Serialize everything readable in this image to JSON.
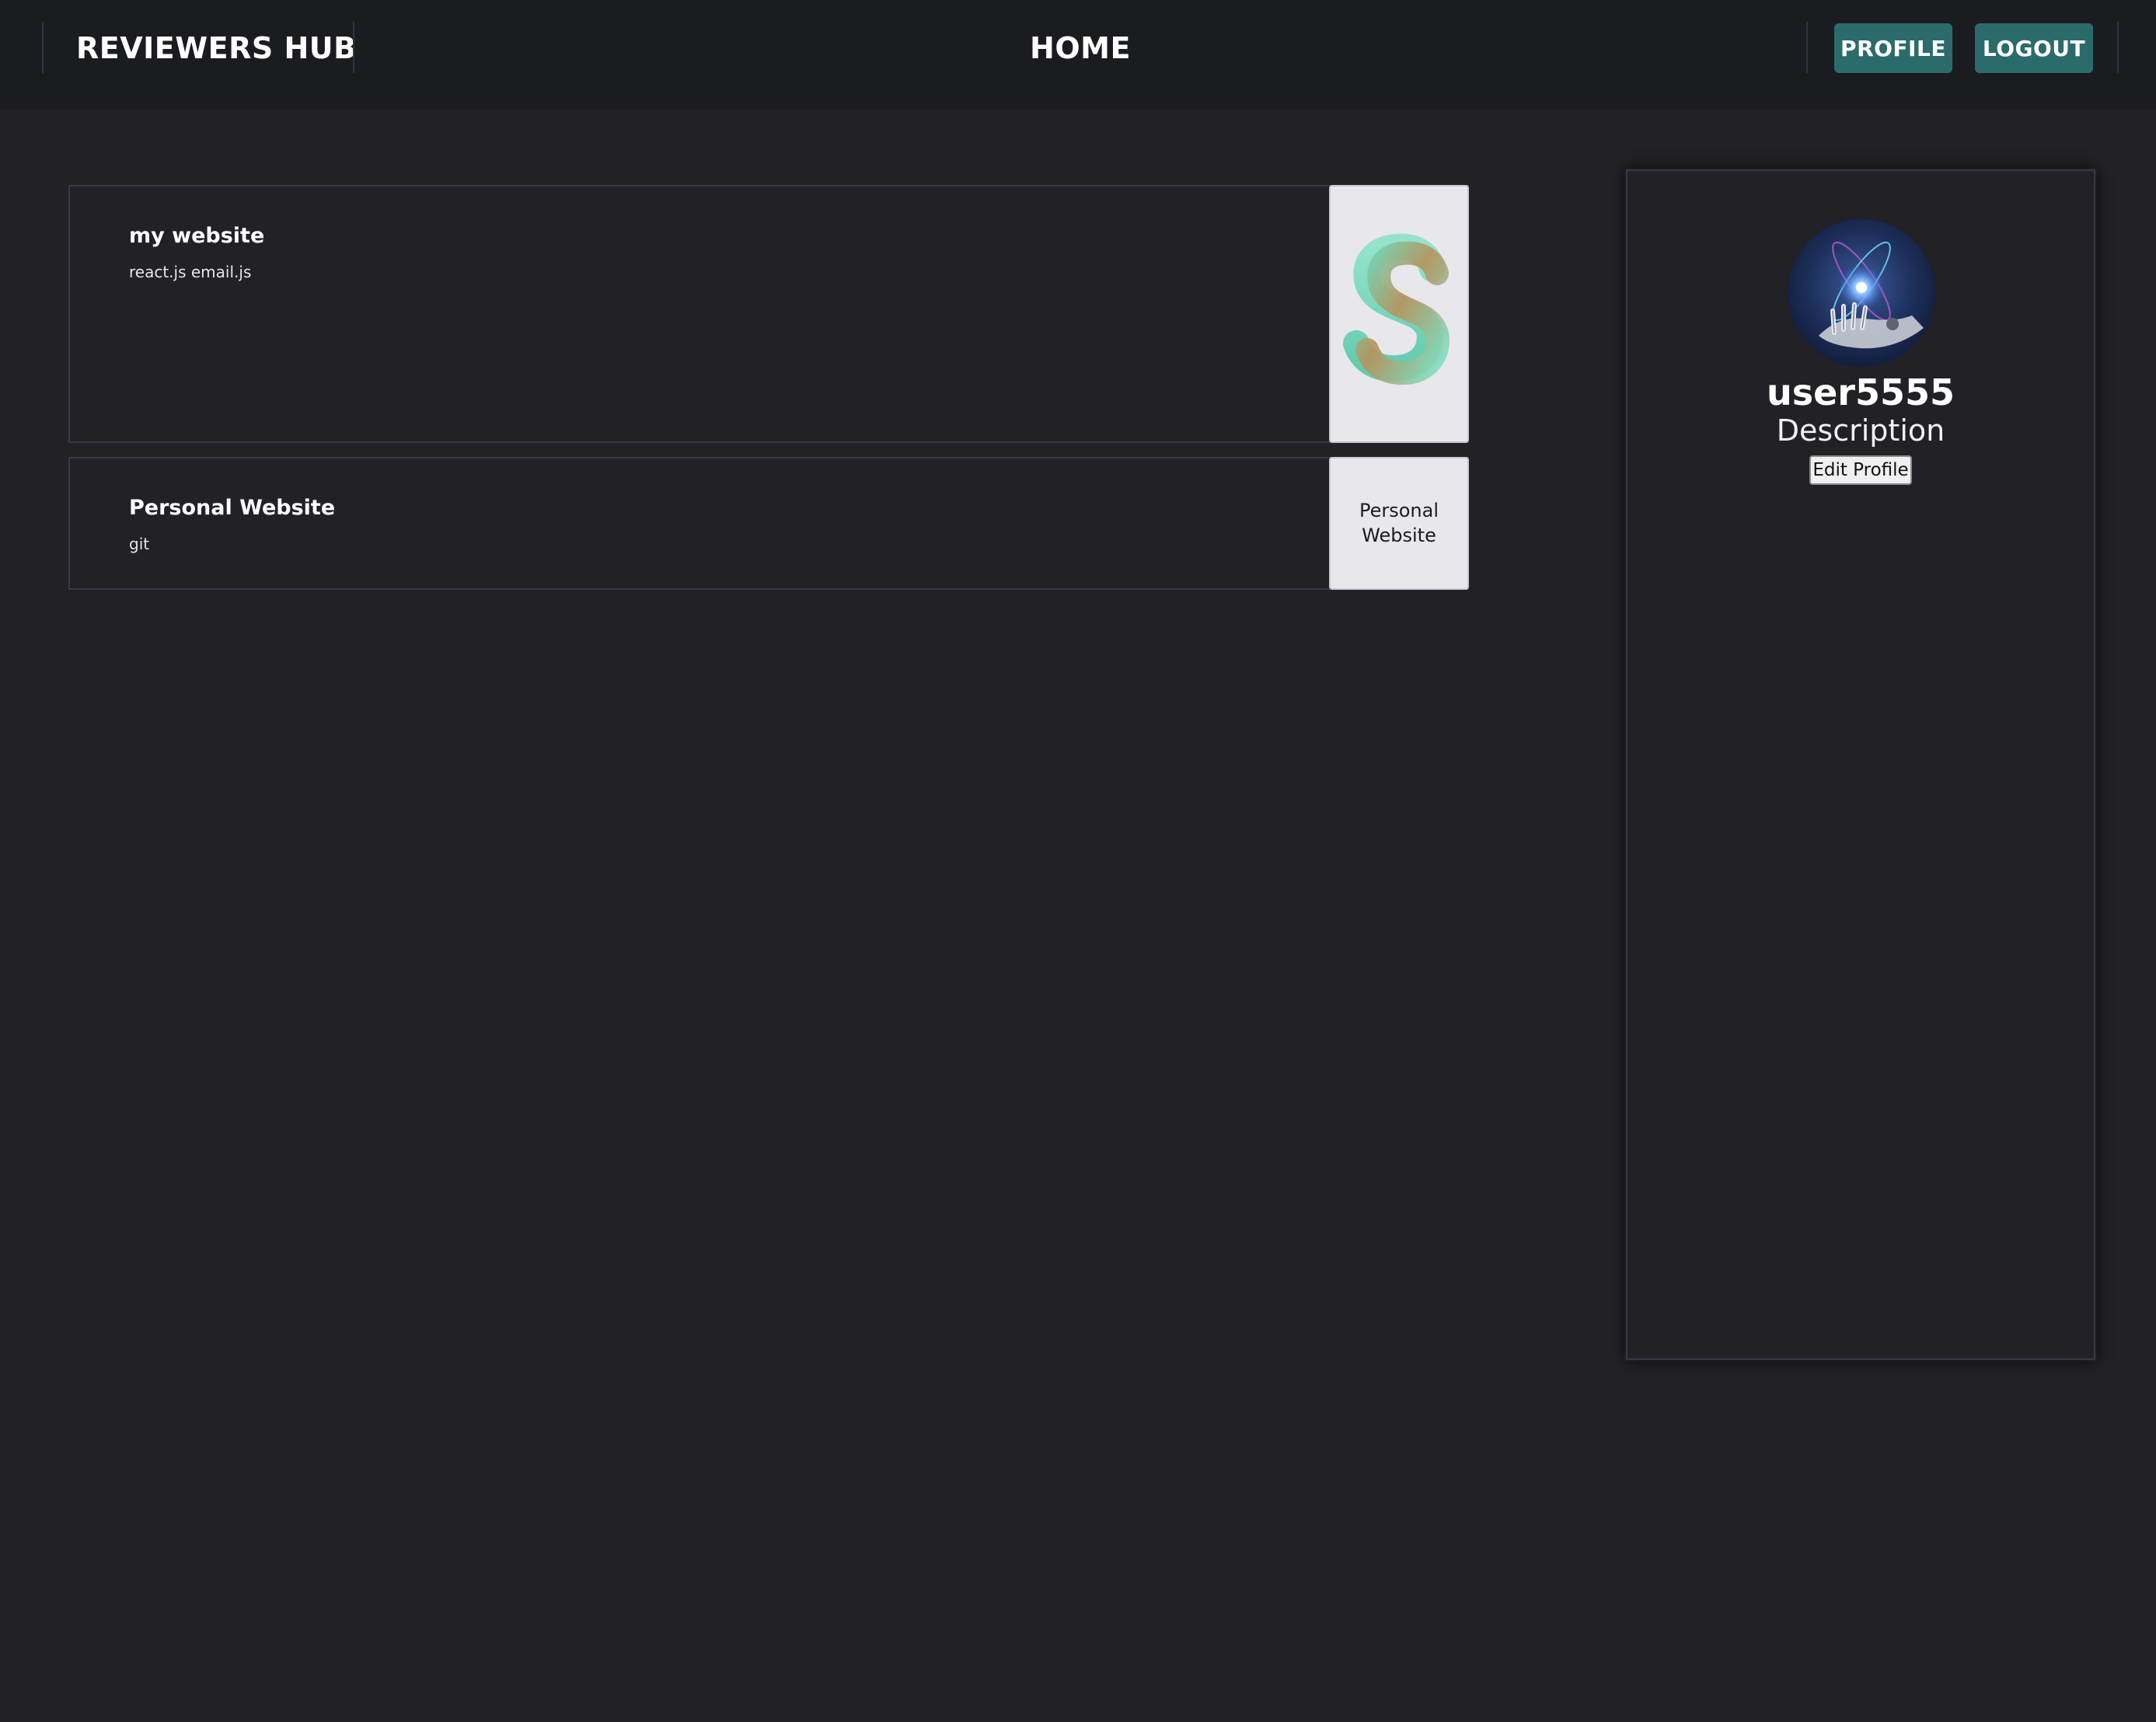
{
  "header": {
    "brand": "REVIEWERS HUB",
    "title": "HOME",
    "profile_label": "PROFILE",
    "logout_label": "LOGOUT"
  },
  "projects": [
    {
      "title": "my website",
      "tags": "react.js email.js",
      "thumbnail_icon": "s-logo-image"
    },
    {
      "title": "Personal Website",
      "tags": "git",
      "thumbnail_text": "Personal Website"
    }
  ],
  "profile": {
    "username": "user5555",
    "description": "Description",
    "edit_label": "Edit Profile",
    "avatar_icon": "robot-hand-avatar"
  },
  "colors": {
    "background": "#212126",
    "header": "#1b1c20",
    "accent_button": "#2c6b6b",
    "thumbnail_bg": "#e8e7ec"
  }
}
